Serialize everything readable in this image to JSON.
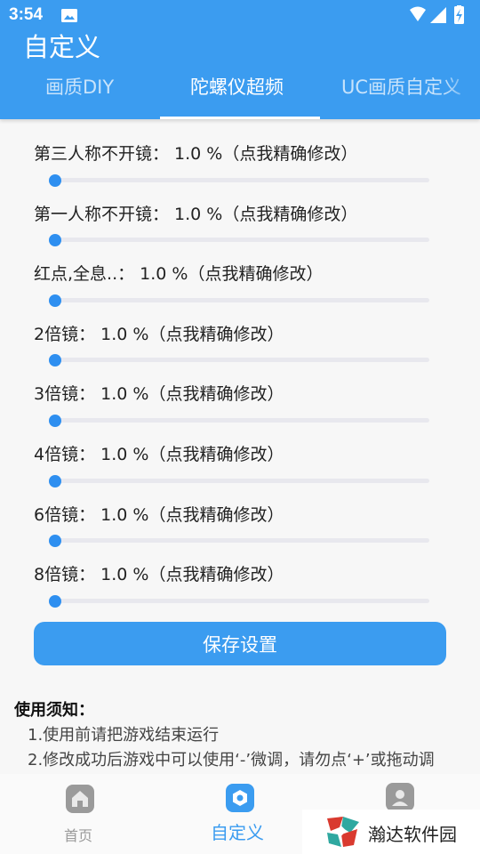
{
  "status_bar": {
    "time": "3:54"
  },
  "app": {
    "title": "自定义"
  },
  "tabs": [
    {
      "label": "画质DIY"
    },
    {
      "label": "陀螺仪超频"
    },
    {
      "label": "UC画质自定义"
    }
  ],
  "settings": [
    {
      "label": "第三人称不开镜：  1.0 %（点我精确修改）",
      "value": 1.0,
      "min": 0,
      "max": 100
    },
    {
      "label": "第一人称不开镜：  1.0 %（点我精确修改）",
      "value": 1.0,
      "min": 0,
      "max": 100
    },
    {
      "label": "红点,全息..：  1.0 %（点我精确修改）",
      "value": 1.0,
      "min": 0,
      "max": 100
    },
    {
      "label": "2倍镜：  1.0 %（点我精确修改）",
      "value": 1.0,
      "min": 0,
      "max": 100
    },
    {
      "label": "3倍镜：  1.0 %（点我精确修改）",
      "value": 1.0,
      "min": 0,
      "max": 100
    },
    {
      "label": "4倍镜：  1.0 %（点我精确修改）",
      "value": 1.0,
      "min": 0,
      "max": 100
    },
    {
      "label": "6倍镜：  1.0 %（点我精确修改）",
      "value": 1.0,
      "min": 0,
      "max": 100
    },
    {
      "label": "8倍镜：  1.0 %（点我精确修改）",
      "value": 1.0,
      "min": 0,
      "max": 100
    }
  ],
  "save_button": {
    "label": "保存设置"
  },
  "notice": {
    "title": "使用须知：",
    "lines": [
      "1.使用前请把游戏结束运行",
      "2.修改成功后游戏中可以使用‘-’微调，请勿点‘+’或拖动调"
    ]
  },
  "bottom_nav": [
    {
      "label": "首页",
      "active": false
    },
    {
      "label": "自定义",
      "active": true
    },
    {
      "label": "",
      "active": false
    }
  ],
  "watermark": {
    "text": "瀚达软件园"
  },
  "colors": {
    "primary": "#3b9cf0",
    "thumb": "#2e8ff0",
    "track": "#e8e8ee",
    "background": "#f7f7f7"
  }
}
